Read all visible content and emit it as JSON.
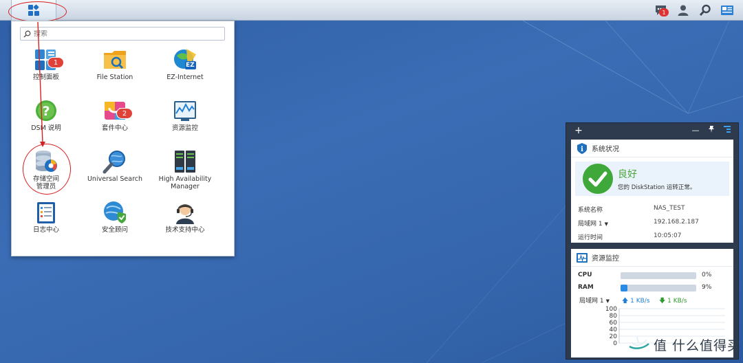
{
  "taskbar": {
    "main_menu_icon": "grid-apps-icon",
    "notification_icon": "chat-bubble-icon",
    "notification_count": "1",
    "user_icon": "user-icon",
    "search_icon": "search-icon",
    "widgets_icon": "widgets-icon"
  },
  "menu": {
    "search_placeholder": "搜索",
    "apps": [
      {
        "label": "控制面板",
        "icon": "control-panel-icon",
        "badge": "1"
      },
      {
        "label": "File Station",
        "icon": "folder-icon",
        "badge": ""
      },
      {
        "label": "EZ-Internet",
        "icon": "globe-ez-icon",
        "badge": ""
      },
      {
        "label": "DSM 说明",
        "icon": "help-icon",
        "badge": ""
      },
      {
        "label": "套件中心",
        "icon": "package-center-icon",
        "badge": "2"
      },
      {
        "label": "资源监控",
        "icon": "resource-monitor-icon",
        "badge": ""
      },
      {
        "label": "存储空间\n管理员",
        "icon": "storage-manager-icon",
        "badge": ""
      },
      {
        "label": "Universal Search",
        "icon": "universal-search-icon",
        "badge": ""
      },
      {
        "label": "High Availability\nManager",
        "icon": "server-icon",
        "badge": ""
      },
      {
        "label": "日志中心",
        "icon": "log-center-icon",
        "badge": ""
      },
      {
        "label": "安全顾问",
        "icon": "security-advisor-icon",
        "badge": ""
      },
      {
        "label": "技术支持中心",
        "icon": "support-center-icon",
        "badge": ""
      }
    ]
  },
  "widget": {
    "add_label": "+",
    "minimize_label": "—",
    "system_health": {
      "title": "系统状况",
      "status": "良好",
      "description": "您的 DiskStation 运转正常。",
      "rows": [
        {
          "key": "系统名称",
          "value": "NAS_TEST"
        },
        {
          "key": "局域网 1",
          "value": "192.168.2.187"
        },
        {
          "key": "运行时间",
          "value": "10:05:07"
        }
      ]
    },
    "resource_monitor": {
      "title": "资源监控",
      "cpu_label": "CPU",
      "cpu_pct": "0%",
      "cpu_value": 0,
      "ram_label": "RAM",
      "ram_pct": "9%",
      "ram_value": 9,
      "lan_label": "局域网 1",
      "upload": "1 KB/s",
      "download": "1 KB/s",
      "chart_ticks": [
        "100",
        "80",
        "60",
        "40",
        "20",
        "0"
      ]
    }
  },
  "watermark": "值 什么值得买",
  "colors": {
    "accent": "#2b8be3",
    "good": "#4aa63a",
    "badge": "#e0423a",
    "annotation": "#d62020"
  }
}
